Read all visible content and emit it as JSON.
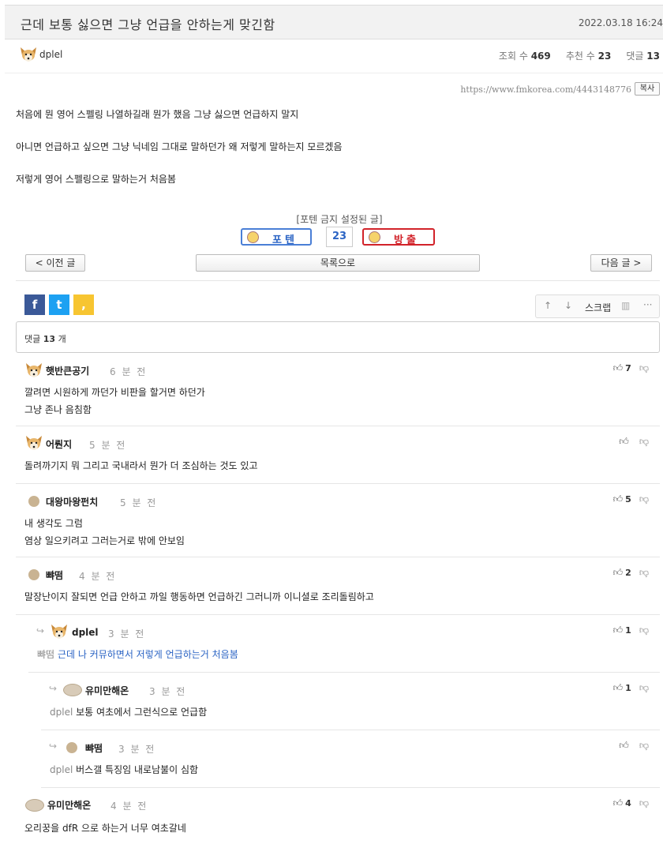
{
  "post": {
    "title": "근데 보통 싫으면 그냥 언급을 안하는게 맞긴함",
    "date": "2022.03.18 16:24",
    "author": "dplel",
    "views_label": "조회 수",
    "views": "469",
    "recommend_label": "추천 수",
    "recommend": "23",
    "comments_label": "댓글",
    "comments": "13",
    "url": "https://www.fmkorea.com/4443148776",
    "copy_label": "복사",
    "lines": [
      "처음에 뭔 영어 스펠링 나열하길래 뭔가 했음 그냥 싫으면 언급하지 말지",
      "아니면 언급하고 싶으면 그냥 닉네임 그대로 말하던가 왜 저렇게 말하는지 모르겠음",
      "저렇게 영어 스펠링으로 말하는거 처음봄"
    ]
  },
  "vote": {
    "banned_label": "[포텐 금지 설정된 글]",
    "up_label": "포텐",
    "count": "23",
    "down_label": "방출"
  },
  "nav": {
    "prev": "< 이전 글",
    "list": "목록으로",
    "next": "다음 글 >"
  },
  "share": {
    "facebook": "f",
    "twitter": "t",
    "kakao": ","
  },
  "tools": {
    "scrap": "스크랩"
  },
  "comment_box": {
    "label": "댓글",
    "count": "13",
    "unit": "개"
  },
  "comments": [
    {
      "name": "햇반큰공기",
      "time": "6 분 전",
      "text1": "깔려면 시원하게 까던가 비판을 할거면 하던가",
      "text2": "그냥 존나 음침함",
      "votes": "7"
    },
    {
      "name": "어뤈지",
      "time": "5 분 전",
      "text1": "돌려까기지 뭐 그리고 국내라서 뭔가 더 조심하는 것도 있고",
      "votes": ""
    },
    {
      "name": "대왕마왕펀치",
      "time": "5 분 전",
      "text1": "내 생각도 그럼",
      "text2": "염상 일으키려고 그러는거로 밖에 안보임",
      "votes": "5"
    },
    {
      "name": "뺘떰",
      "time": "4 분 전",
      "text1": "말장난이지 잘되면 언급 안하고 까일 행동하면 언급하긴 그러니까 이니셜로 조리돌림하고",
      "votes": "2"
    },
    {
      "name": "dplel",
      "time": "3 분 전",
      "mention": "뺘떰",
      "text1": "근데 나 커뮤하면서 저렇게 언급하는거 처음봄",
      "votes": "1"
    },
    {
      "name": "유미만해온",
      "time": "3 분 전",
      "mention": "dplel",
      "text1": "보통 여초에서 그런식으로 언급함",
      "votes": "1"
    },
    {
      "name": "뺘떰",
      "time": "3 분 전",
      "mention": "dplel",
      "text1": "버스갤 특징임 내로남불이 심함",
      "votes": ""
    },
    {
      "name": "유미만해온",
      "time": "4 분 전",
      "text1": "오리꿍을 dfR 으로 하는거 너무 여초갈네",
      "votes": "4"
    }
  ]
}
